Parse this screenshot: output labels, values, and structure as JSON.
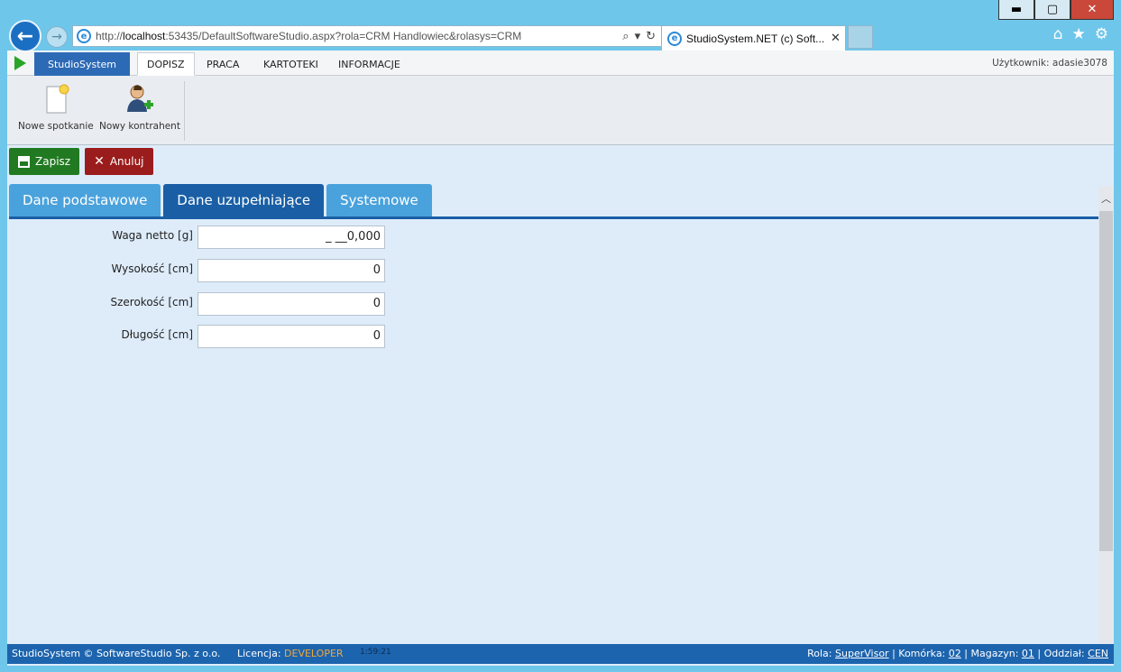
{
  "window": {
    "minimize": "▬",
    "maximize": "▢",
    "close": "✕"
  },
  "browser": {
    "url_prefix": "http://",
    "url_host": "localhost",
    "url_rest": ":53435/DefaultSoftwareStudio.aspx?rola=CRM Handlowiec&rolasys=CRM",
    "tab_title": "StudioSystem.NET (c) Soft...",
    "back": "←",
    "forward": "→",
    "search_icon": "⌕",
    "dropdown_icon": "▾",
    "refresh_icon": "↻",
    "tab_close": "✕",
    "home_icon": "⌂",
    "favorites_icon": "★",
    "settings_icon": "⚙"
  },
  "menu": {
    "brand": "StudioSystem",
    "tabs": [
      "DOPISZ",
      "PRACA",
      "KARTOTEKI",
      "INFORMACJE"
    ],
    "user_label": "Użytkownik: adasie3078"
  },
  "ribbon": {
    "buttons": [
      "Nowe spotkanie",
      "Nowy kontrahent"
    ]
  },
  "actions": {
    "save": "Zapisz",
    "cancel": "Anuluj"
  },
  "form_tabs": [
    "Dane podstawowe",
    "Dane uzupełniające",
    "Systemowe"
  ],
  "fields": [
    {
      "label": "Waga netto [g]",
      "value": "_ __0,000"
    },
    {
      "label": "Wysokość [cm]",
      "value": "0"
    },
    {
      "label": "Szerokość [cm]",
      "value": "0"
    },
    {
      "label": "Długość [cm]",
      "value": "0"
    }
  ],
  "status": {
    "copyright": "StudioSystem © SoftwareStudio Sp. z o.o.",
    "license_label": "Licencja:",
    "license_value": "DEVELOPER",
    "time": "1:59:21",
    "rola_label": "Rola:",
    "rola_value": "SuperVisor",
    "komorka_label": "Komórka:",
    "komorka_value": "02",
    "magazyn_label": "Magazyn:",
    "magazyn_value": "01",
    "oddzial_label": "Oddział:",
    "oddzial_value": "CEN"
  },
  "colors": {
    "primary": "#1a5fa5",
    "tab_inactive": "#4aa2dc",
    "save": "#217a21",
    "cancel": "#9b1c1c",
    "license": "#f0a83a"
  }
}
